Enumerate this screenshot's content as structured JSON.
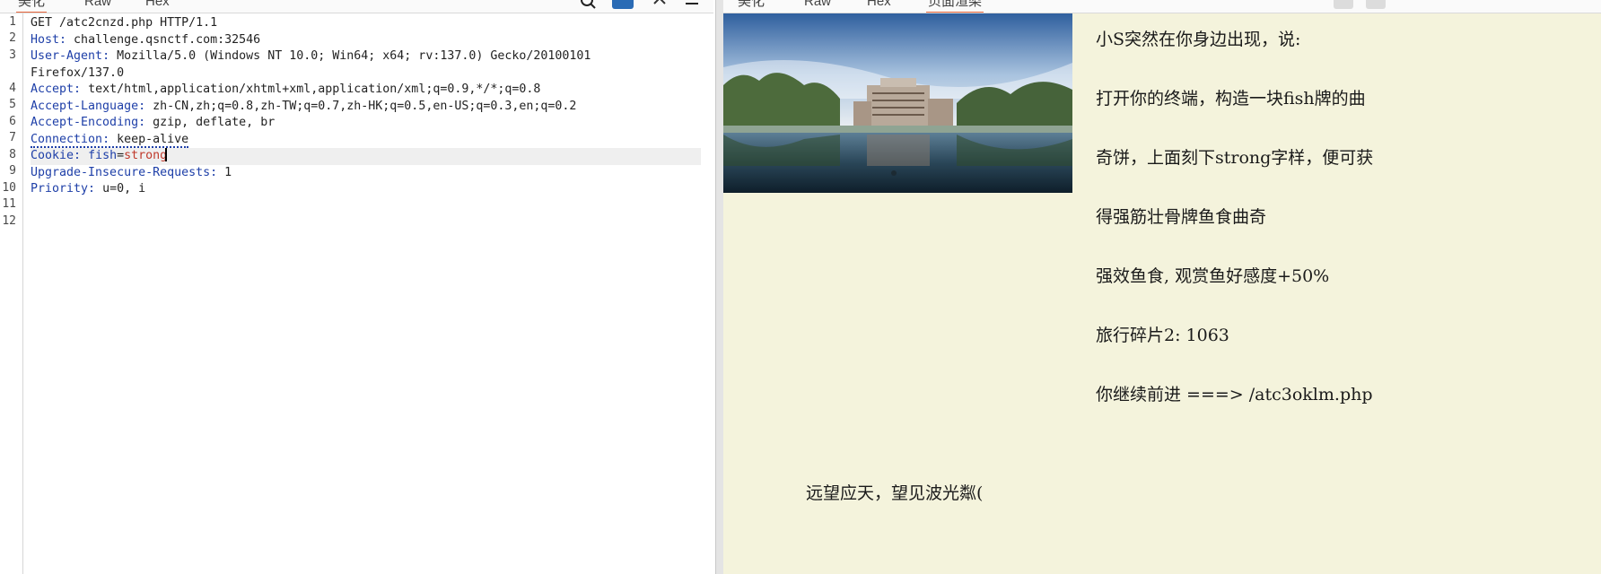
{
  "request_tabs": [
    "美化",
    "Raw",
    "Hex"
  ],
  "response_tabs": [
    "美化",
    "Raw",
    "Hex",
    "页面渲染"
  ],
  "line_numbers": [
    "1",
    "2",
    "3",
    "4",
    "5",
    "6",
    "7",
    "8",
    "9",
    "10",
    "11",
    "12"
  ],
  "request": {
    "l1": "GET /atc2cnzd.php HTTP/1.1",
    "host_k": "Host",
    "host_v": " challenge.qsnctf.com:32546",
    "ua_k": "User-Agent",
    "ua_v": " Mozilla/5.0 (Windows NT 10.0; Win64; x64; rv:137.0) Gecko/20100101",
    "ua_cont": "Firefox/137.0",
    "accept_k": "Accept",
    "accept_v": " text/html,application/xhtml+xml,application/xml;q=0.9,*/*;q=0.8",
    "al_k": "Accept-Language",
    "al_v": " zh-CN,zh;q=0.8,zh-TW;q=0.7,zh-HK;q=0.5,en-US;q=0.3,en;q=0.2",
    "ae_k": "Accept-Encoding",
    "ae_v": " gzip, deflate, br",
    "conn_k": "Connection",
    "conn_v": " keep-alive",
    "cookie_k": "Cookie",
    "cookie_name": "fish",
    "cookie_eq": "=",
    "cookie_val": "strong",
    "uir_k": "Upgrade-Insecure-Requests",
    "uir_v": " 1",
    "pri_k": "Priority",
    "pri_v": " u=0, i"
  },
  "colon": ":",
  "response": {
    "p1": "小S突然在你身边出现，说:",
    "p2": "打开你的终端，构造一块fish牌的曲",
    "p3": "奇饼，上面刻下strong字样，便可获",
    "p4": "得强筋壮骨牌鱼食曲奇",
    "p5": "强效鱼食, 观赏鱼好感度+50%",
    "p6": "旅行碎片2: 1063",
    "p7": "你继续前进 ===> /atc3oklm.php",
    "caption": "远望应天，望见波光粼("
  },
  "colors": {
    "accent": "#e8663d",
    "header_key": "#1e3fa8",
    "cookie_value": "#c0392b",
    "render_bg": "#f4f3dc"
  }
}
